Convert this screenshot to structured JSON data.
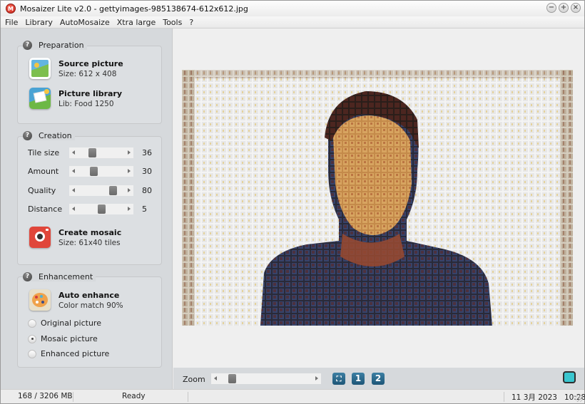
{
  "window": {
    "title": "Mosaizer Lite v2.0 - gettyimages-985138674-612x612.jpg",
    "controls": [
      "minimize",
      "maximize",
      "close"
    ]
  },
  "menu": [
    "File",
    "Library",
    "AutoMosaize",
    "Xtra large",
    "Tools",
    "?"
  ],
  "preparation": {
    "title": "Preparation",
    "source": {
      "title": "Source picture",
      "subtitle": "Size: 612 x 408"
    },
    "library": {
      "title": "Picture library",
      "subtitle": "Lib: Food 1250"
    }
  },
  "creation": {
    "title": "Creation",
    "sliders": [
      {
        "label": "Tile size",
        "value": "36",
        "position": 0.28
      },
      {
        "label": "Amount",
        "value": "30",
        "position": 0.3
      },
      {
        "label": "Quality",
        "value": "80",
        "position": 0.8
      },
      {
        "label": "Distance",
        "value": "5",
        "position": 0.5
      }
    ],
    "create": {
      "title": "Create mosaic",
      "subtitle": "Size: 61x40 tiles"
    }
  },
  "enhancement": {
    "title": "Enhancement",
    "auto": {
      "title": "Auto enhance",
      "subtitle": "Color match 90%"
    },
    "options": [
      {
        "label": "Original picture",
        "checked": false
      },
      {
        "label": "Mosaic picture",
        "checked": true
      },
      {
        "label": "Enhanced picture",
        "checked": false
      }
    ]
  },
  "bottom": {
    "zoom_label": "Zoom",
    "zoom_position": 0.1,
    "buttons": [
      "fit",
      "1",
      "2"
    ]
  },
  "status": {
    "memory": "168 / 3206 MB",
    "state": "Ready",
    "datetime": "11 3月 2023   10:28"
  },
  "colors": {
    "accent": "#2a6b8f",
    "create_icon": "#e0463a",
    "monitor": "#3ac6cf"
  }
}
